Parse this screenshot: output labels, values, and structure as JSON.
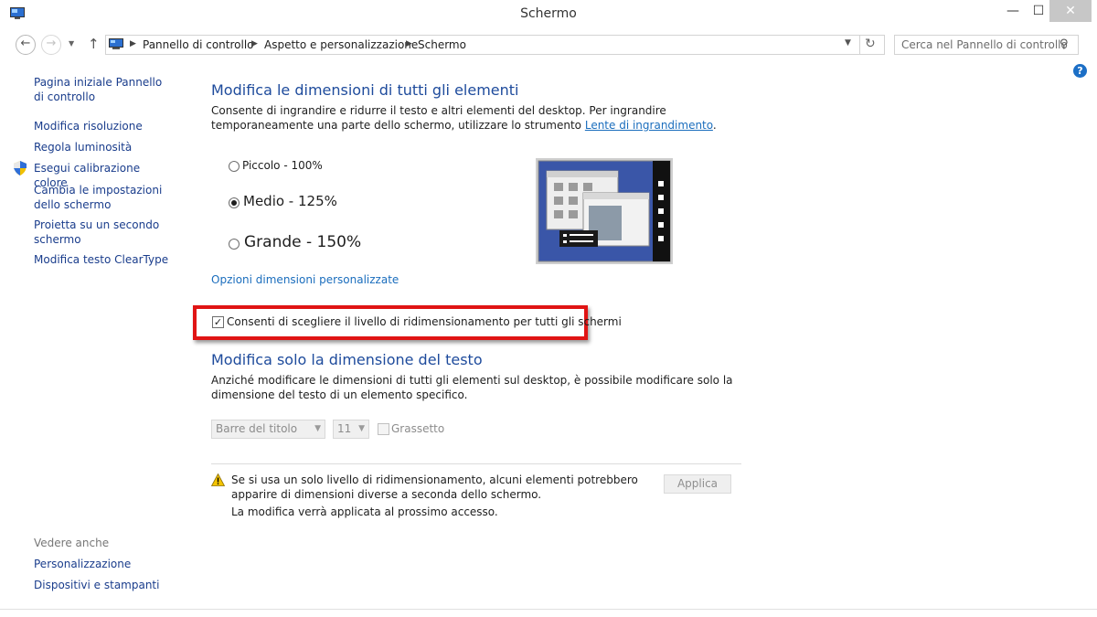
{
  "window": {
    "title": "Schermo",
    "min_glyph": "—",
    "max_glyph": "☐",
    "close_glyph": "✕"
  },
  "addressbar": {
    "crumbs": [
      "Pannello di controllo",
      "Aspetto e personalizzazione",
      "Schermo"
    ],
    "search_placeholder": "Cerca nel Pannello di controllo"
  },
  "sidebar": {
    "items": [
      {
        "label": "Pagina iniziale Pannello di controllo"
      },
      {
        "label": "Modifica risoluzione"
      },
      {
        "label": "Regola luminosità"
      },
      {
        "label": "Esegui calibrazione colore"
      },
      {
        "label": "Cambia le impostazioni dello schermo"
      },
      {
        "label": "Proietta su un secondo schermo"
      },
      {
        "label": "Modifica testo ClearType"
      }
    ],
    "see_also_title": "Vedere anche",
    "see_also": [
      {
        "label": "Personalizzazione"
      },
      {
        "label": "Dispositivi e stampanti"
      }
    ]
  },
  "main": {
    "section1_title": "Modifica le dimensioni di tutti gli elementi",
    "section1_desc_a": "Consente di ingrandire e ridurre il testo e altri elementi del desktop. Per ingrandire temporaneamente una parte dello schermo, utilizzare lo strumento ",
    "section1_desc_link": "Lente di ingrandimento",
    "section1_desc_b": ".",
    "options": [
      {
        "label": "Piccolo - 100%",
        "checked": false
      },
      {
        "label": "Medio - 125%",
        "checked": true
      },
      {
        "label": "Grande - 150%",
        "checked": false
      }
    ],
    "custom_link": "Opzioni dimensioni personalizzate",
    "scaling_checkbox_label": "Consenti di scegliere il livello di ridimensionamento per tutti gli schermi",
    "scaling_checkbox_checked": true,
    "section2_title": "Modifica solo la dimensione del testo",
    "section2_desc": "Anziché modificare le dimensioni di tutti gli elementi sul desktop, è possibile modificare solo la dimensione del testo di un elemento specifico.",
    "element_select_value": "Barre del titolo",
    "size_select_value": "11",
    "bold_label": "Grassetto",
    "warning_text": "Se si usa un solo livello di ridimensionamento, alcuni elementi potrebbero apparire di dimensioni diverse a seconda dello schermo.",
    "notice_text": "La modifica verrà applicata al prossimo accesso.",
    "apply_label": "Applica"
  },
  "colors": {
    "heading": "#1e4b9c",
    "link": "#1a6dbd",
    "highlight_box": "#e01414",
    "preview_bg": "#3a56a8"
  }
}
